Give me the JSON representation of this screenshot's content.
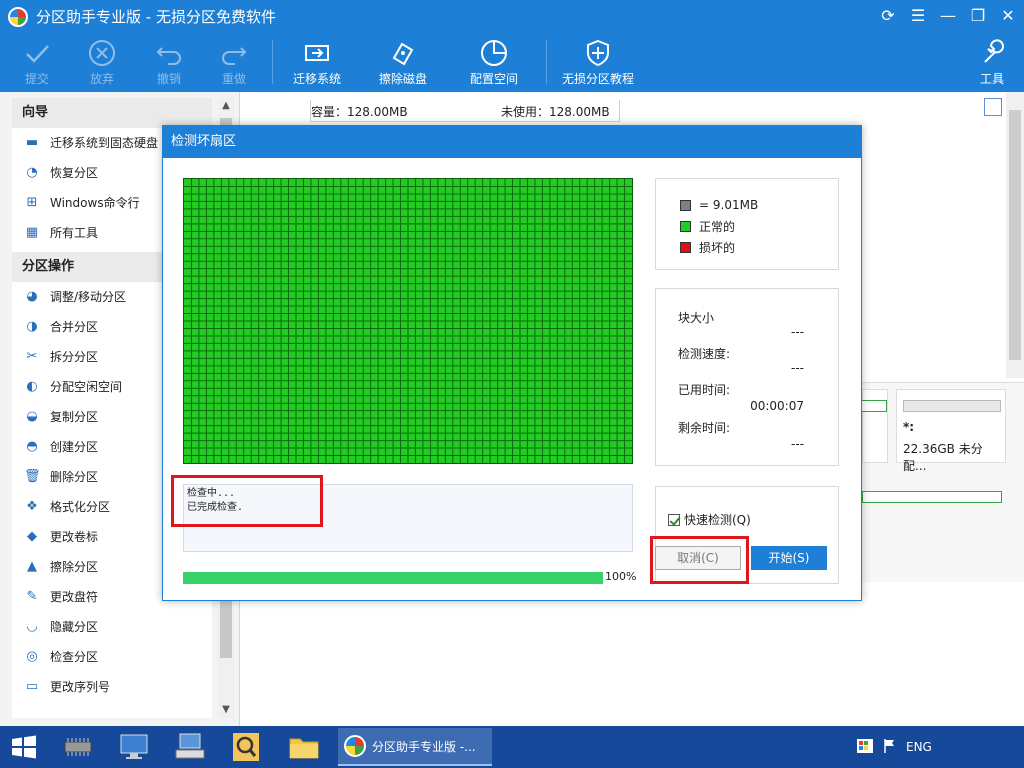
{
  "window": {
    "title": "分区助手专业版 - 无损分区免费软件",
    "controls": [
      "refresh-icon",
      "menu-icon",
      "restore-icon",
      "close-icon"
    ]
  },
  "toolbar": {
    "items": [
      {
        "label": "提交",
        "icon": "check-icon",
        "enabled": false
      },
      {
        "label": "放弃",
        "icon": "cancel-circle-icon",
        "enabled": false
      },
      {
        "label": "撤销",
        "icon": "undo-icon",
        "enabled": false
      },
      {
        "label": "重做",
        "icon": "redo-icon",
        "enabled": false
      },
      {
        "label": "迁移系统",
        "icon": "migrate-icon",
        "enabled": true
      },
      {
        "label": "擦除磁盘",
        "icon": "wipe-disk-icon",
        "enabled": true
      },
      {
        "label": "配置空间",
        "icon": "allocate-space-icon",
        "enabled": true
      },
      {
        "label": "无损分区教程",
        "icon": "shield-icon",
        "enabled": true
      },
      {
        "label": "工具",
        "icon": "tools-icon",
        "enabled": true
      }
    ]
  },
  "sidebar": {
    "sections": [
      {
        "title": "向导",
        "items": [
          {
            "label": "迁移系统到固态硬盘",
            "icon": "ssd-icon"
          },
          {
            "label": "恢复分区",
            "icon": "recover-icon"
          },
          {
            "label": "Windows命令行",
            "icon": "windows-icon"
          },
          {
            "label": "所有工具",
            "icon": "grid-icon"
          }
        ]
      },
      {
        "title": "分区操作",
        "items": [
          {
            "label": "调整/移动分区",
            "icon": "resize-icon"
          },
          {
            "label": "合并分区",
            "icon": "merge-icon"
          },
          {
            "label": "拆分分区",
            "icon": "split-icon"
          },
          {
            "label": "分配空闲空间",
            "icon": "allocate-icon"
          },
          {
            "label": "复制分区",
            "icon": "copy-icon"
          },
          {
            "label": "创建分区",
            "icon": "create-icon"
          },
          {
            "label": "删除分区",
            "icon": "delete-icon"
          },
          {
            "label": "格式化分区",
            "icon": "format-icon"
          },
          {
            "label": "更改卷标",
            "icon": "label-icon"
          },
          {
            "label": "擦除分区",
            "icon": "wipe-icon"
          },
          {
            "label": "更改盘符",
            "icon": "drive-letter-icon"
          },
          {
            "label": "隐藏分区",
            "icon": "hide-icon"
          },
          {
            "label": "检查分区",
            "icon": "check-partition-icon"
          },
          {
            "label": "更改序列号",
            "icon": "serial-icon"
          }
        ]
      }
    ]
  },
  "main": {
    "capacity": "容量：128.00MB",
    "unused": "未使用：128.00MB",
    "partition_label": "*:",
    "partition_info": "22.36GB 未分配..."
  },
  "dialog": {
    "title": "检测坏扇区",
    "legend": [
      {
        "label": "= 9.01MB",
        "color": "#808080"
      },
      {
        "label": "正常的",
        "color": "#22cc22"
      },
      {
        "label": "损坏的",
        "color": "#dd1111"
      }
    ],
    "stats": {
      "block_size_label": "块大小",
      "block_size_value": "---",
      "speed_label": "检测速度:",
      "speed_value": "---",
      "elapsed_label": "已用时间:",
      "elapsed_value": "00:00:07",
      "remaining_label": "剩余时间:",
      "remaining_value": "---"
    },
    "log": [
      "检查中...",
      "已完成检查."
    ],
    "progress": 100,
    "progress_text": "100%",
    "quick_check_label": "快速检测(Q)",
    "quick_check_checked": true,
    "cancel_label": "取消(C)",
    "start_label": "开始(S)",
    "grid": {
      "columns": 60,
      "rows": 38,
      "cell_color": "#22cc22",
      "line_color": "#0e6b0e"
    }
  },
  "taskbar": {
    "app_label": "分区助手专业版 -...",
    "lang": "ENG",
    "icons": [
      "windows-start-icon",
      "chip-icon",
      "computer-icon",
      "keyboard-icon",
      "search-app-icon",
      "folder-icon"
    ]
  }
}
